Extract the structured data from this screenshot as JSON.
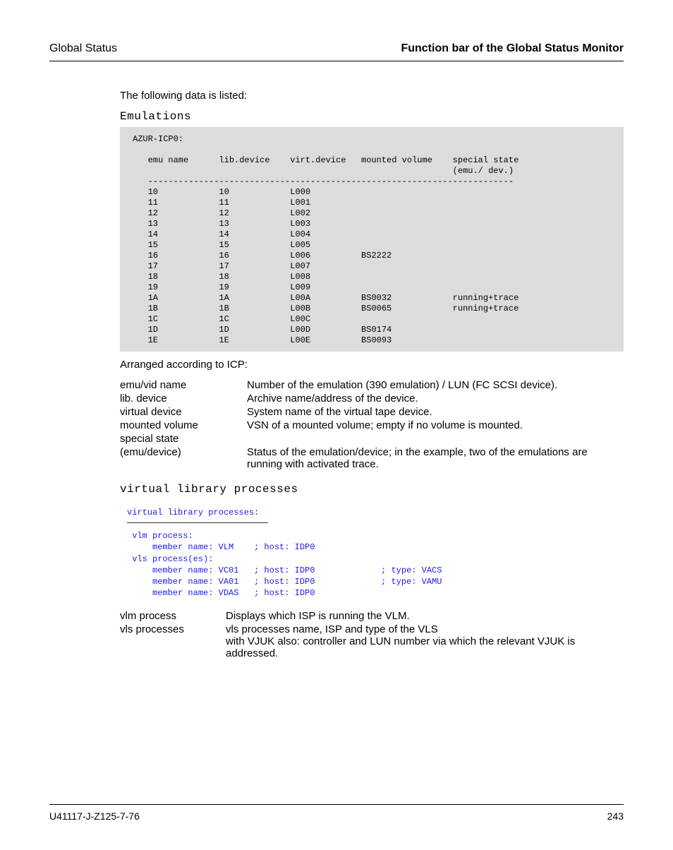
{
  "header": {
    "left": "Global Status",
    "right": "Function bar of the Global Status Monitor"
  },
  "intro": "The following data is listed:",
  "emulationsLabel": "Emulations",
  "emu": {
    "host": "AZUR-ICP0:",
    "cols": {
      "c1": "emu name",
      "c2": "lib.device",
      "c3": "virt.device",
      "c4": "mounted volume",
      "c5a": "special state",
      "c5b": "(emu./ dev.)"
    },
    "rows": [
      {
        "c1": "10",
        "c2": "10",
        "c3": "L000",
        "c4": "",
        "c5": ""
      },
      {
        "c1": "11",
        "c2": "11",
        "c3": "L001",
        "c4": "",
        "c5": ""
      },
      {
        "c1": "12",
        "c2": "12",
        "c3": "L002",
        "c4": "",
        "c5": ""
      },
      {
        "c1": "13",
        "c2": "13",
        "c3": "L003",
        "c4": "",
        "c5": ""
      },
      {
        "c1": "14",
        "c2": "14",
        "c3": "L004",
        "c4": "",
        "c5": ""
      },
      {
        "c1": "15",
        "c2": "15",
        "c3": "L005",
        "c4": "",
        "c5": ""
      },
      {
        "c1": "16",
        "c2": "16",
        "c3": "L006",
        "c4": "BS2222",
        "c5": ""
      },
      {
        "c1": "17",
        "c2": "17",
        "c3": "L007",
        "c4": "",
        "c5": ""
      },
      {
        "c1": "18",
        "c2": "18",
        "c3": "L008",
        "c4": "",
        "c5": ""
      },
      {
        "c1": "19",
        "c2": "19",
        "c3": "L009",
        "c4": "",
        "c5": ""
      },
      {
        "c1": "1A",
        "c2": "1A",
        "c3": "L00A",
        "c4": "BS0032",
        "c5": "running+trace"
      },
      {
        "c1": "1B",
        "c2": "1B",
        "c3": "L00B",
        "c4": "BS0065",
        "c5": "running+trace"
      },
      {
        "c1": "1C",
        "c2": "1C",
        "c3": "L00C",
        "c4": "",
        "c5": ""
      },
      {
        "c1": "1D",
        "c2": "1D",
        "c3": "L00D",
        "c4": "BS0174",
        "c5": ""
      },
      {
        "c1": "1E",
        "c2": "1E",
        "c3": "L00E",
        "c4": "BS0093",
        "c5": ""
      }
    ]
  },
  "arranged": "Arranged according to ICP:",
  "defs": [
    {
      "term": "emu/vid name",
      "desc": "Number of the emulation (390 emulation) / LUN (FC SCSI device)."
    },
    {
      "term": "lib. device",
      "desc": "Archive name/address of the device."
    },
    {
      "term": "virtual device",
      "desc": "System name of the virtual tape device."
    },
    {
      "term": "mounted volume",
      "desc": "VSN of a mounted volume; empty if no volume is mounted."
    },
    {
      "term": "special state",
      "desc": ""
    },
    {
      "term": "(emu/device)",
      "desc": "Status of the emulation/device; in the example, two of the emulations are running with activated trace."
    }
  ],
  "vlpLabel": "virtual library processes",
  "vlp": {
    "title": "virtual library processes:",
    "vlmLabel": "vlm process:",
    "vlmLine": "     member name: VLM    ; host: IDP0",
    "vlsLabel": "vls process(es):",
    "vlsLines": [
      "     member name: VC01   ; host: IDP0             ; type: VACS",
      "     member name: VA01   ; host: IDP0             ; type: VAMU",
      "     member name: VDAS   ; host: IDP0"
    ]
  },
  "defs2": [
    {
      "term": "vlm process",
      "desc": "Displays which ISP is running the VLM."
    },
    {
      "term": "vls processes",
      "desc": "vls processes name, ISP and type of the VLS\nwith VJUK also: controller and LUN number via which the relevant VJUK is addressed."
    }
  ],
  "footer": {
    "left": "U41117-J-Z125-7-76",
    "right": "243"
  }
}
